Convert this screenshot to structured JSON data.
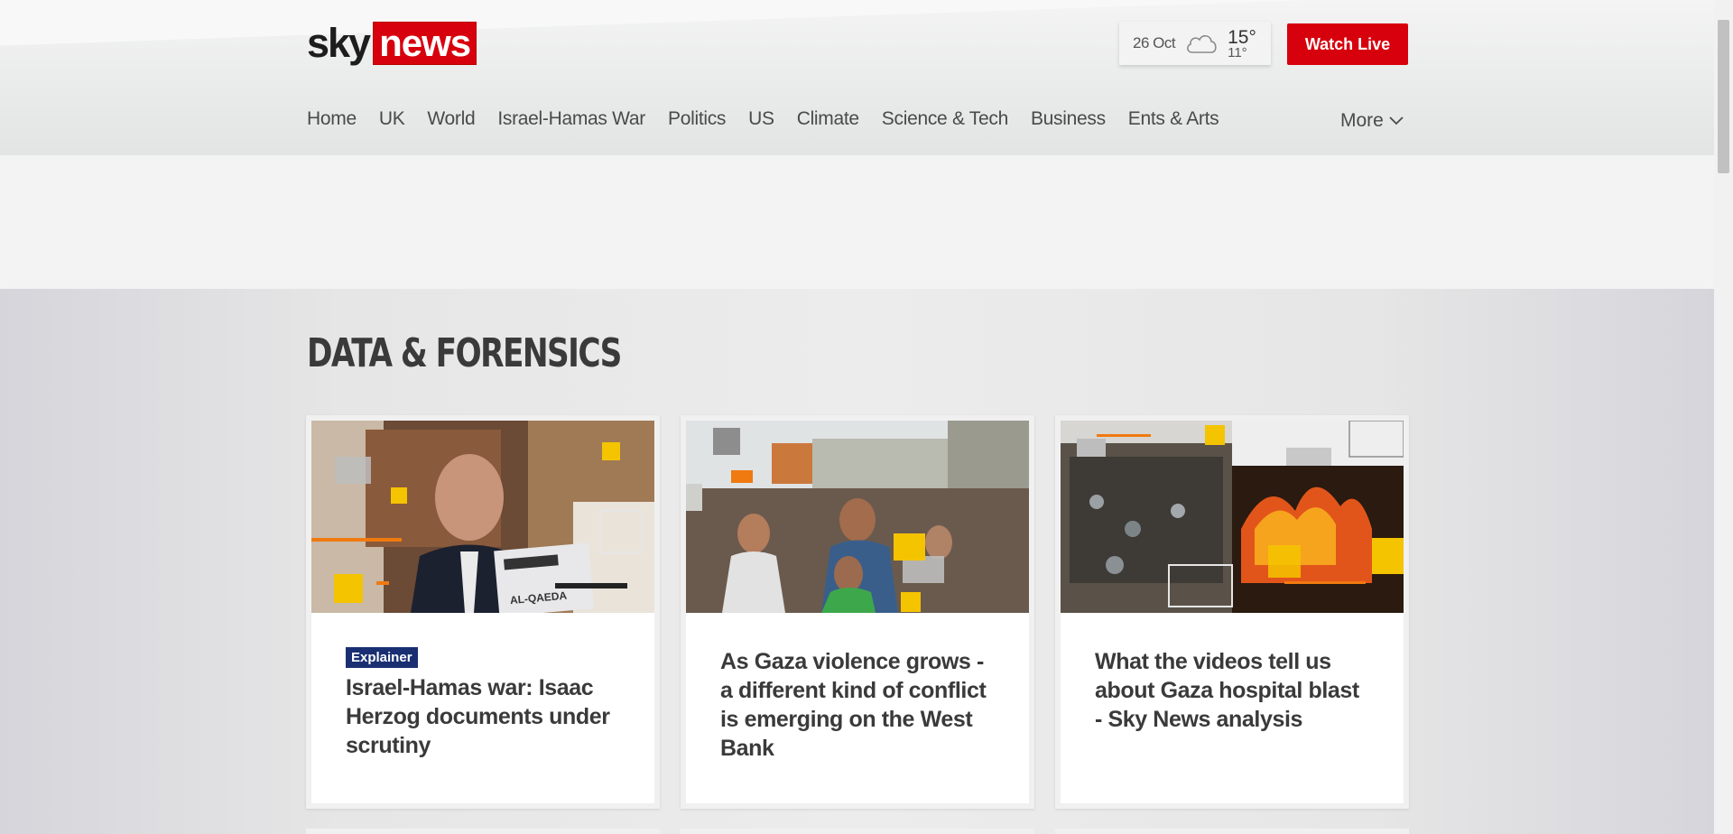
{
  "header": {
    "logo_left": "sky",
    "logo_right": "news",
    "weather": {
      "date": "26 Oct",
      "icon": "cloud-icon",
      "high": "15°",
      "low": "11°"
    },
    "watch_live_label": "Watch Live"
  },
  "nav": {
    "items": [
      {
        "label": "Home"
      },
      {
        "label": "UK"
      },
      {
        "label": "World"
      },
      {
        "label": "Israel-Hamas War"
      },
      {
        "label": "Politics"
      },
      {
        "label": "US"
      },
      {
        "label": "Climate"
      },
      {
        "label": "Science & Tech"
      },
      {
        "label": "Business"
      },
      {
        "label": "Ents & Arts"
      }
    ],
    "more_label": "More"
  },
  "section": {
    "title": "DATA & FORENSICS",
    "cards": [
      {
        "badge": "Explainer",
        "headline": "Israel-Hamas war: Isaac Herzog documents under scrutiny",
        "image_text": "AL-QAEDA"
      },
      {
        "badge": "",
        "headline": "As Gaza violence grows - a different kind of conflict is emerging on the West Bank"
      },
      {
        "badge": "",
        "headline": "What the videos tell us about Gaza hospital blast - Sky News analysis"
      }
    ]
  },
  "colors": {
    "brand_red": "#d7010d",
    "badge_blue": "#1a2f72",
    "accent_yellow": "#f5c400",
    "accent_orange": "#f07a10"
  }
}
